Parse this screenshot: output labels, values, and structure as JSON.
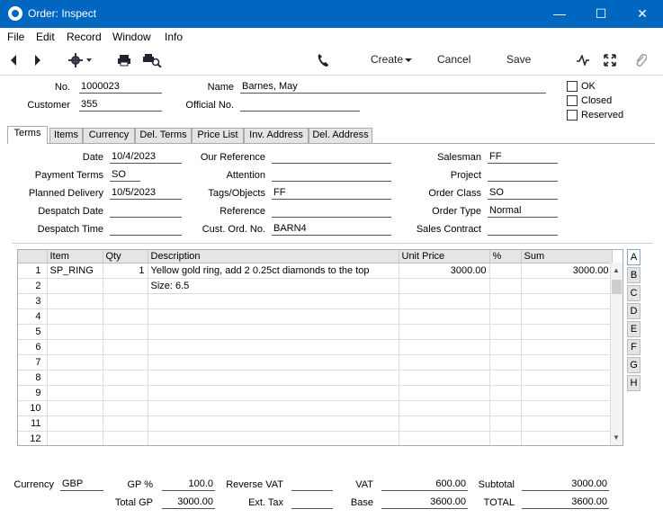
{
  "window": {
    "title": "Order: Inspect"
  },
  "menu": [
    "File",
    "Edit",
    "Record",
    "Window",
    "Info"
  ],
  "toolbar": {
    "create": "Create",
    "cancel": "Cancel",
    "save": "Save"
  },
  "header": {
    "no_label": "No.",
    "no_value": "1000023",
    "name_label": "Name",
    "name_value": "Barnes, May",
    "customer_label": "Customer",
    "customer_value": "355",
    "official_label": "Official No.",
    "official_value": "",
    "ok_label": "OK",
    "closed_label": "Closed",
    "reserved_label": "Reserved"
  },
  "tabs": [
    "Terms",
    "Items",
    "Currency",
    "Del. Terms",
    "Price List",
    "Inv. Address",
    "Del. Address"
  ],
  "terms": {
    "date_label": "Date",
    "date": "10/4/2023",
    "payment_terms_label": "Payment Terms",
    "payment_terms": "SO",
    "planned_delivery_label": "Planned Delivery",
    "planned_delivery": "10/5/2023",
    "despatch_date_label": "Despatch Date",
    "despatch_date": "",
    "despatch_time_label": "Despatch Time",
    "despatch_time": "",
    "our_ref_label": "Our Reference",
    "our_ref": "",
    "attention_label": "Attention",
    "attention": "",
    "tags_label": "Tags/Objects",
    "tags": "FF",
    "reference_label": "Reference",
    "reference": "",
    "cust_ord_label": "Cust. Ord. No.",
    "cust_ord": "BARN4",
    "salesman_label": "Salesman",
    "salesman": "FF",
    "project_label": "Project",
    "project": "",
    "order_class_label": "Order Class",
    "order_class": "SO",
    "order_type_label": "Order Type",
    "order_type": "Normal",
    "sales_contract_label": "Sales Contract",
    "sales_contract": ""
  },
  "grid": {
    "columns": [
      "",
      "Item",
      "Qty",
      "Description",
      "Unit Price",
      "%",
      "Sum"
    ],
    "rows": [
      [
        "1",
        "SP_RING",
        "1",
        "Yellow gold ring, add 2 0.25ct diamonds to the top",
        "3000.00",
        "",
        "3000.00"
      ],
      [
        "2",
        "",
        "",
        "Size: 6.5",
        "",
        "",
        ""
      ],
      [
        "3",
        "",
        "",
        "",
        "",
        "",
        ""
      ],
      [
        "4",
        "",
        "",
        "",
        "",
        "",
        ""
      ],
      [
        "5",
        "",
        "",
        "",
        "",
        "",
        ""
      ],
      [
        "6",
        "",
        "",
        "",
        "",
        "",
        ""
      ],
      [
        "7",
        "",
        "",
        "",
        "",
        "",
        ""
      ],
      [
        "8",
        "",
        "",
        "",
        "",
        "",
        ""
      ],
      [
        "9",
        "",
        "",
        "",
        "",
        "",
        ""
      ],
      [
        "10",
        "",
        "",
        "",
        "",
        "",
        ""
      ],
      [
        "11",
        "",
        "",
        "",
        "",
        "",
        ""
      ],
      [
        "12",
        "",
        "",
        "",
        "",
        "",
        ""
      ]
    ],
    "side_tabs": [
      "A",
      "B",
      "C",
      "D",
      "E",
      "F",
      "G",
      "H"
    ]
  },
  "footer": {
    "currency_label": "Currency",
    "currency": "GBP",
    "gp_pct_label": "GP %",
    "gp_pct": "100.0",
    "total_gp_label": "Total GP",
    "total_gp": "3000.00",
    "reverse_vat_label": "Reverse VAT",
    "reverse_vat": "",
    "ext_tax_label": "Ext. Tax",
    "ext_tax": "",
    "vat_label": "VAT",
    "vat": "600.00",
    "base_label": "Base",
    "base": "3600.00",
    "subtotal_label": "Subtotal",
    "subtotal": "3000.00",
    "total_label": "TOTAL",
    "total": "3600.00"
  }
}
